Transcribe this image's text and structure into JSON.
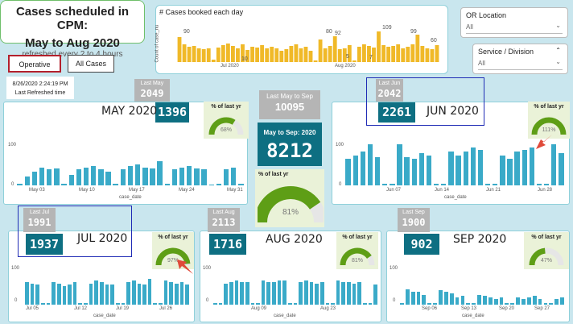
{
  "header": {
    "title_line1": "Cases scheduled in CPM:",
    "title_line2": "May to Aug  2020",
    "subtitle": "refreshed every 2 to 4 hours",
    "btn_operative": "Operative Cases",
    "btn_all": "All Cases",
    "refresh_time": "8/26/2020 2:24:19 PM",
    "refresh_label": "Last Refreshed time"
  },
  "daily_chart": {
    "title": "# Cases booked each day",
    "ylabel": "Count of case_nu",
    "xticks": [
      "Jul 2020",
      "Aug 2020"
    ],
    "data_labels": [
      "90",
      "10",
      "80",
      "5",
      "92",
      "7",
      "109",
      "99",
      "60"
    ]
  },
  "slicers": {
    "or_location": {
      "label": "OR Location",
      "value": "All"
    },
    "service": {
      "label": "Service / Division",
      "value": "All"
    }
  },
  "summary": {
    "last_label": "Last May to Sep",
    "last_value": "10095",
    "current_label": "May to Sep: 2020",
    "current_value": "8212",
    "gauge_label": "% of last yr",
    "gauge_pct": "81%",
    "gauge_fraction": 0.81
  },
  "months": [
    {
      "key": "may",
      "title": "MAY 2020",
      "last_label": "Last May",
      "last_value": "2049",
      "value": "1396",
      "gauge_label": "% of last yr",
      "gauge_pct": "68%",
      "gauge_fraction": 0.68,
      "xticks": [
        "May 03",
        "May 10",
        "May 17",
        "May 24",
        "May 31"
      ],
      "xlabel": "case_date",
      "yticks": [
        "100",
        "0"
      ],
      "values": [
        5,
        25,
        40,
        50,
        45,
        48,
        5,
        30,
        45,
        50,
        55,
        45,
        40,
        5,
        45,
        55,
        60,
        50,
        48,
        70,
        5,
        45,
        50,
        55,
        48,
        45,
        2,
        5,
        45,
        50,
        5
      ]
    },
    {
      "key": "jun",
      "title": "JUN 2020",
      "last_label": "Last Jun",
      "last_value": "2042",
      "value": "2261",
      "gauge_label": "% of last yr",
      "gauge_pct": "111%",
      "gauge_fraction": 1.0,
      "xticks": [
        "Jun 07",
        "Jun 14",
        "Jun 21",
        "Jun 28"
      ],
      "xlabel": "case_date",
      "yticks": [
        "100",
        "0"
      ],
      "values": [
        70,
        80,
        90,
        110,
        75,
        5,
        5,
        110,
        75,
        70,
        85,
        80,
        5,
        5,
        90,
        80,
        90,
        100,
        95,
        5,
        5,
        80,
        70,
        90,
        95,
        100,
        5,
        5,
        110,
        85
      ]
    },
    {
      "key": "jul",
      "title": "JUL 2020",
      "last_label": "Last Jul",
      "last_value": "1991",
      "value": "1937",
      "gauge_label": "% of last yr",
      "gauge_pct": "97%",
      "gauge_fraction": 0.97,
      "xticks": [
        "Jul 05",
        "Jul 12",
        "Jul 19",
        "Jul 26"
      ],
      "xlabel": "case_date",
      "yticks": [
        "100",
        "0"
      ],
      "values": [
        80,
        75,
        70,
        5,
        5,
        80,
        75,
        65,
        70,
        80,
        5,
        5,
        75,
        85,
        80,
        70,
        70,
        5,
        5,
        80,
        85,
        75,
        70,
        90,
        5,
        5,
        85,
        80,
        75,
        80,
        70
      ]
    },
    {
      "key": "aug",
      "title": "AUG 2020",
      "last_label": "Last Aug",
      "last_value": "2113",
      "value": "1716",
      "gauge_label": "% of last yr",
      "gauge_pct": "81%",
      "gauge_fraction": 0.81,
      "xticks": [
        "Aug 09",
        "Aug 23"
      ],
      "xlabel": "case_date",
      "yticks": [
        "100",
        "0"
      ],
      "values": [
        5,
        5,
        75,
        80,
        85,
        80,
        80,
        5,
        5,
        85,
        80,
        80,
        85,
        85,
        5,
        5,
        80,
        85,
        80,
        75,
        80,
        5,
        5,
        85,
        80,
        80,
        75,
        80,
        5,
        5,
        70
      ]
    },
    {
      "key": "sep",
      "title": "SEP 2020",
      "last_label": "Last Sep",
      "last_value": "1900",
      "value": "902",
      "gauge_label": "% of last yr",
      "gauge_pct": "47%",
      "gauge_fraction": 0.47,
      "xticks": [
        "Sep 06",
        "Sep 13",
        "Sep 20",
        "Sep 27"
      ],
      "xlabel": "case_date",
      "yticks": [
        "100",
        "0"
      ],
      "values": [
        5,
        55,
        45,
        45,
        35,
        5,
        5,
        50,
        45,
        40,
        25,
        30,
        5,
        5,
        35,
        30,
        25,
        20,
        25,
        5,
        5,
        25,
        20,
        25,
        30,
        20,
        5,
        5,
        20,
        25
      ]
    }
  ],
  "colors": {
    "teal": "#0e6f82",
    "bar": "#3aaac8",
    "gauge": "#5e9e16",
    "daily_bar": "#f0b928",
    "highlight": "#1f2bb5",
    "arrow": "#e04a3a"
  }
}
